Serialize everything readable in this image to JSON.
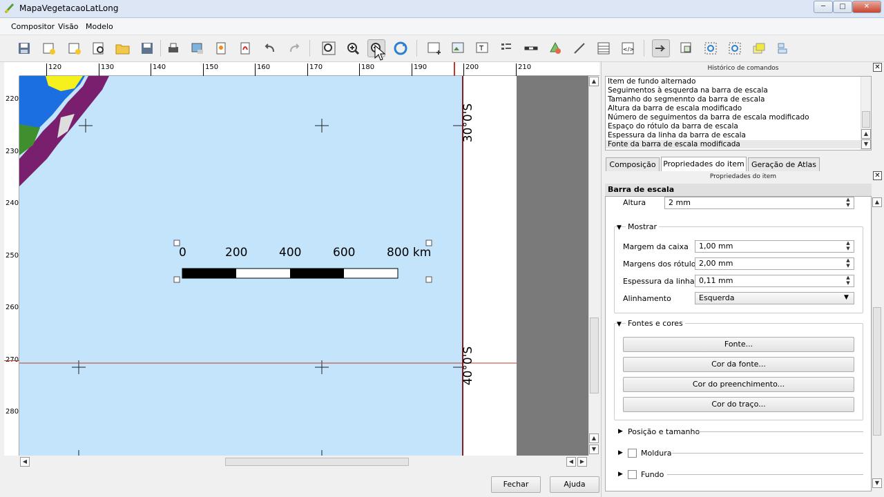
{
  "window": {
    "title": "MapaVegetacaoLatLong",
    "minimize": "─",
    "maximize": "□",
    "close": "✕"
  },
  "menu": [
    "Compositor",
    "Visão",
    "Modelo"
  ],
  "ruler_h": [
    "120",
    "130",
    "140",
    "150",
    "160",
    "170",
    "180",
    "190",
    "200",
    "210"
  ],
  "ruler_v": [
    "220",
    "230",
    "240",
    "250",
    "260",
    "270",
    "280"
  ],
  "map": {
    "lat_label_1": "30°0'S",
    "lat_label_2": "40°0'S",
    "scalebar_labels": [
      "0",
      "200",
      "400",
      "600",
      "800 km"
    ],
    "colors": {
      "ocean": "#c3e4fa",
      "vegetation": "#7a1f6e",
      "green": "#3f8f2f",
      "yellow": "#f6f01c",
      "blue": "#1c6fe0",
      "frame_line": "#8b1a1a"
    }
  },
  "history": {
    "header": "Histórico de comandos",
    "items": [
      "Item de fundo alternado",
      "Seguimentos à esquerda na barra de escala",
      "Tamanho do segmennto da barra de escala",
      "Altura da barra de escala modificado",
      "Número de seguimentos da barra de escala modificado",
      "Espaço do rótulo da barra de escala",
      "Espessura da linha da barra de escala",
      "Fonte da barra de escala modificada"
    ]
  },
  "tabs": [
    "Composição",
    "Propriedades do item",
    "Geração de Atlas"
  ],
  "props": {
    "header": "Propriedades do item",
    "item_title": "Barra de escala",
    "altura_label": "Altura",
    "altura_value": "2 mm",
    "mostrar": "Mostrar",
    "margem_caixa_label": "Margem da caixa",
    "margem_caixa_value": "1,00 mm",
    "margens_rotulos_label": "Margens dos rótulos",
    "margens_rotulos_value": "2,00 mm",
    "espessura_label": "Espessura da linha",
    "espessura_value": "0,11 mm",
    "alinhamento_label": "Alinhamento",
    "alinhamento_value": "Esquerda",
    "fontes_cores": "Fontes e cores",
    "fonte_btn": "Fonte...",
    "cor_fonte_btn": "Cor da fonte...",
    "cor_preench_btn": "Cor do preenchimento...",
    "cor_traco_btn": "Cor do traço...",
    "posicao": "Posição e tamanho",
    "moldura": "Moldura",
    "fundo": "Fundo"
  },
  "buttons": {
    "close": "Fechar",
    "help": "Ajuda"
  }
}
